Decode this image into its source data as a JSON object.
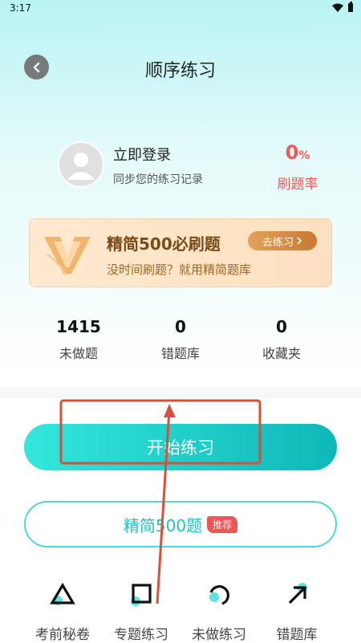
{
  "status": {
    "time": "3:17"
  },
  "header": {
    "title": "顺序练习"
  },
  "profile": {
    "login_title": "立即登录",
    "login_sub": "同步您的练习记录",
    "rate_value": "0",
    "rate_unit": "%",
    "rate_label": "刷题率"
  },
  "banner": {
    "title": "精简500必刷题",
    "button": "去练习",
    "subtitle": "没时间刷题？就用精简题库"
  },
  "stats": [
    {
      "value": "1415",
      "label": "未做题"
    },
    {
      "value": "0",
      "label": "错题库"
    },
    {
      "value": "0",
      "label": "收藏夹"
    }
  ],
  "actions": {
    "start": "开始练习",
    "simple": "精简500题",
    "simple_tag": "推荐"
  },
  "tabs": [
    {
      "label": "考前秘卷",
      "icon": "triangle-icon"
    },
    {
      "label": "专题练习",
      "icon": "square-icon"
    },
    {
      "label": "未做练习",
      "icon": "circle-arc-icon"
    },
    {
      "label": "错题库",
      "icon": "arrow-up-right-icon"
    }
  ],
  "annotation": {
    "highlight_color": "#d9503a"
  }
}
